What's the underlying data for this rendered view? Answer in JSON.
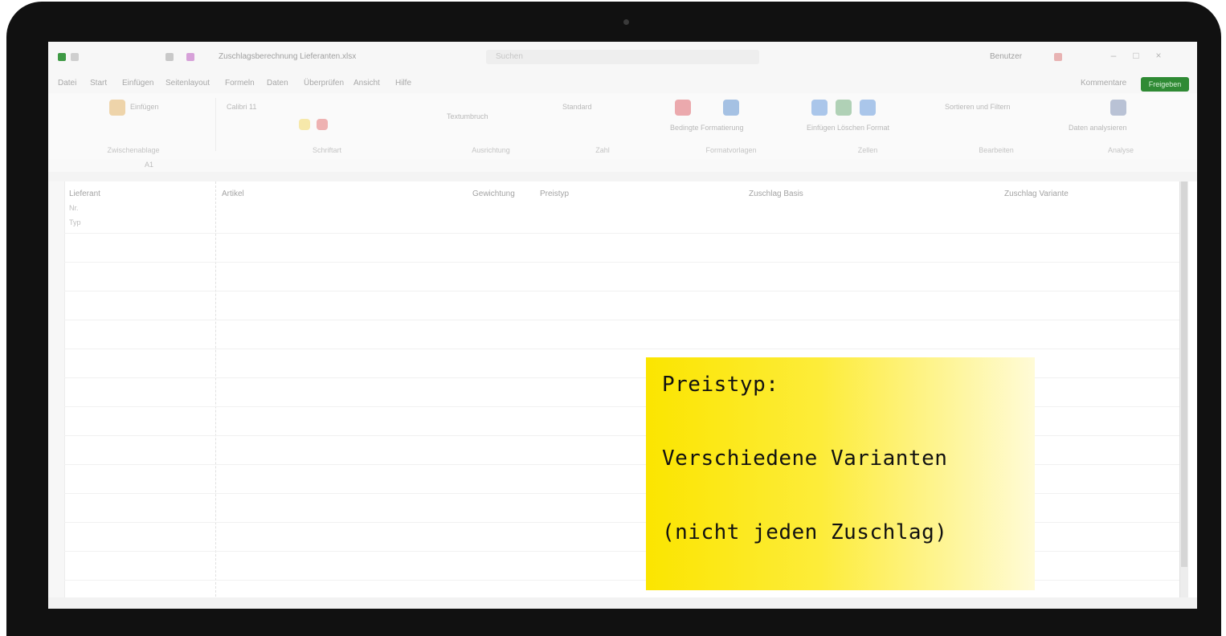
{
  "title_bar": {
    "document_title": "Zuschlagsberechnung Lieferanten.xlsx",
    "search_placeholder": "Suchen",
    "user_name": "Benutzer"
  },
  "menu": {
    "tabs": [
      "Datei",
      "Start",
      "Einfügen",
      "Seitenlayout",
      "Formeln",
      "Daten",
      "Überprüfen",
      "Ansicht",
      "Hilfe"
    ],
    "extra_label": "Kommentare",
    "share_label": "Freigeben"
  },
  "ribbon": {
    "groups": [
      {
        "label": "Zwischenablage",
        "text": "Einfügen"
      },
      {
        "label": "Schriftart",
        "text": "Calibri 11"
      },
      {
        "label": "Ausrichtung",
        "text": "Textumbruch"
      },
      {
        "label": "Zahl",
        "text": "Standard"
      },
      {
        "label": "Formatvorlagen",
        "text": "Bedingte Formatierung"
      },
      {
        "label": "Zellen",
        "text": "Einfügen Löschen Format"
      },
      {
        "label": "Bearbeiten",
        "text": "Sortieren und Filtern"
      },
      {
        "label": "Analyse",
        "text": "Daten analysieren"
      }
    ]
  },
  "formula_bar": {
    "name_box": "A1"
  },
  "grid": {
    "column_headers": [
      "Lieferant",
      "Artikel",
      "Gewichtung",
      "Preistyp",
      "Zuschlag Basis",
      "Zuschlag Variante"
    ],
    "row_header_labels": [
      "Nr.",
      "Typ"
    ]
  },
  "callout": {
    "line1": "Preistyp:",
    "line2": "Verschiedene Varianten",
    "line3": "(nicht jeden Zuschlag)"
  },
  "colors": {
    "callout_yellow": "#fbe500",
    "share_green": "#2f8a34",
    "frame": "#111111"
  }
}
